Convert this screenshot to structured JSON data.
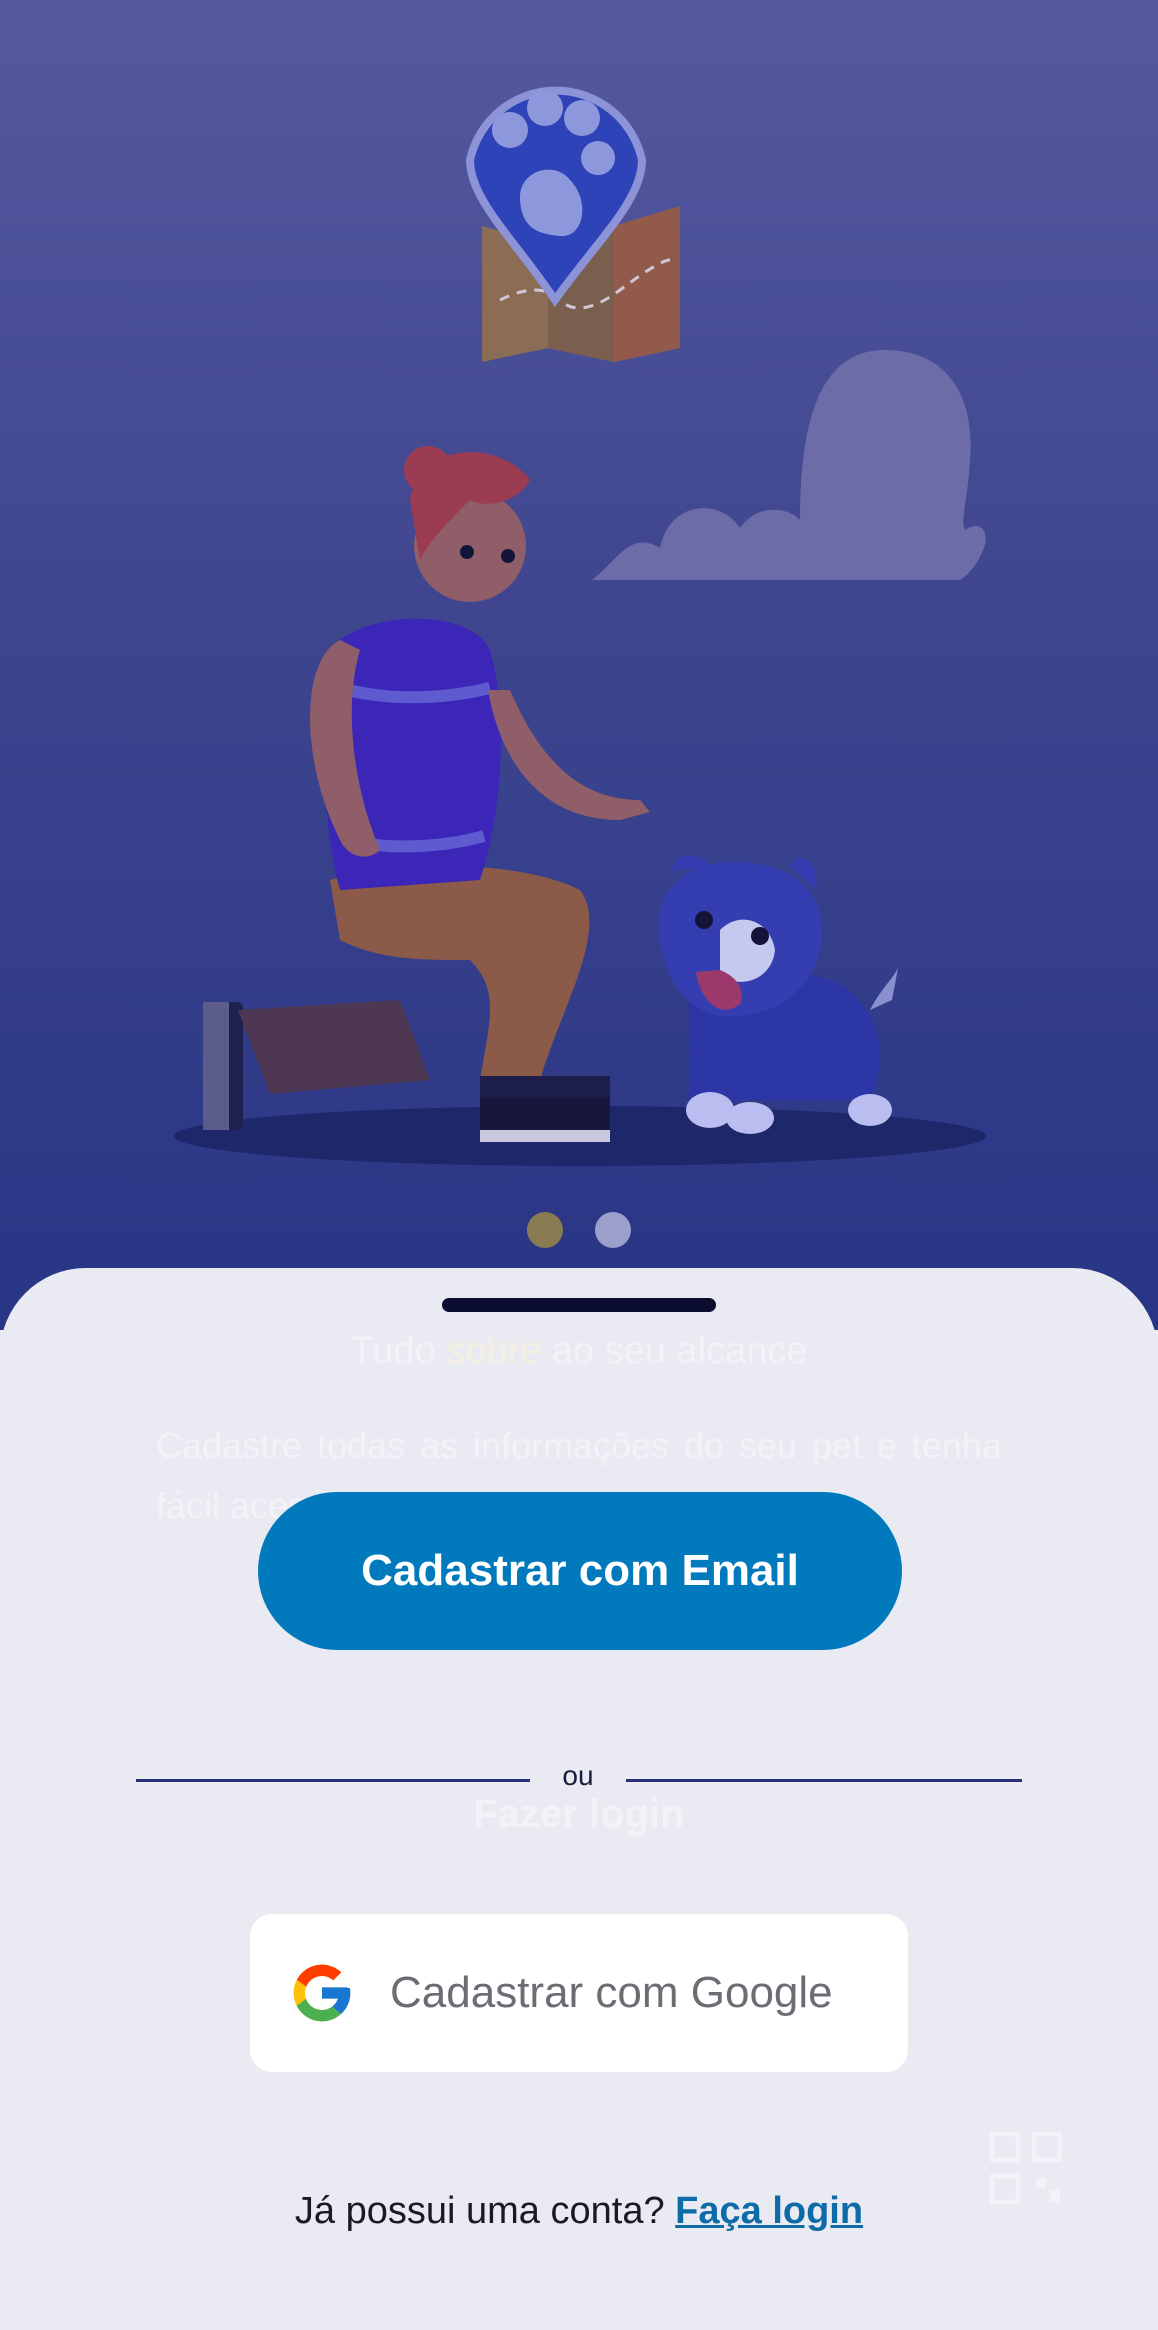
{
  "onboarding": {
    "title_pre": "Tudo ",
    "title_highlight": "sobre",
    "title_post": " ao seu alcance",
    "description": "Cadastre todas as informações do seu pet e tenha fácil acesso a elas em qualquer momento",
    "ghost_login": "Fazer login",
    "pagination": {
      "total": 2,
      "active_index": 0
    }
  },
  "actions": {
    "email_button": "Cadastrar com Email",
    "divider_text": "ou",
    "google_button": "Cadastrar com Google"
  },
  "footer": {
    "prompt": "Já possui uma conta?",
    "link": "Faça login"
  },
  "colors": {
    "primary": "#0079bd",
    "hero_top": "#55599f",
    "hero_bottom": "#283585",
    "sheet": "#e9eaf2",
    "link": "#0d6ba8"
  },
  "icons": [
    "paw-location-pin-icon",
    "map-icon",
    "cloud-icon",
    "google-g-icon",
    "qr-code-icon"
  ]
}
